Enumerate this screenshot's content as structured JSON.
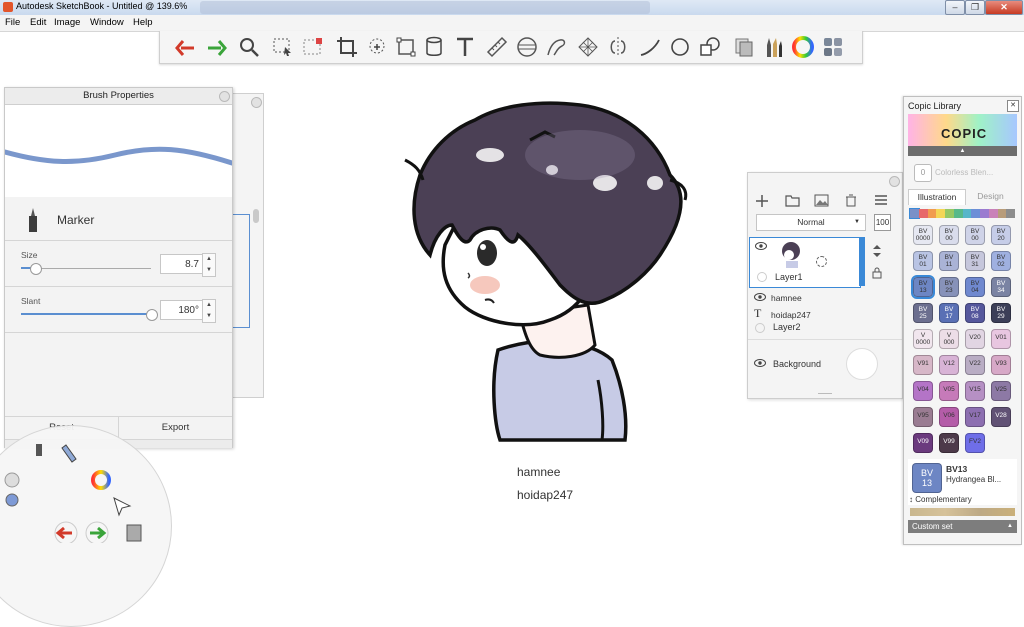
{
  "window": {
    "title": "Autodesk SketchBook - Untitled @ 139.6%",
    "controls": {
      "minimize": "‒",
      "maximize": "❐",
      "close": "✕"
    }
  },
  "menu": [
    "File",
    "Edit",
    "Image",
    "Window",
    "Help"
  ],
  "toolbar": {
    "tools": [
      "undo",
      "redo",
      "zoom",
      "select",
      "crop-select",
      "crop",
      "lasso-transform",
      "distort",
      "cylinder",
      "text",
      "ruler",
      "ellipse",
      "french-curve",
      "perspective-grid",
      "symmetry",
      "stroke-line",
      "circle",
      "shapes",
      "layer-copy",
      "brush-library",
      "color-wheel",
      "copic-library"
    ]
  },
  "brush_properties": {
    "title": "Brush Properties",
    "brush_name": "Marker",
    "size_label": "Size",
    "size_value": "8.7",
    "size_fraction": 0.11,
    "slant_label": "Slant",
    "slant_value": "180°",
    "slant_fraction": 1.0,
    "reset_label": "Reset",
    "export_label": "Export",
    "stroke_color": "#7a97cc"
  },
  "layers": {
    "blend_mode": "Normal",
    "opacity": "100",
    "items": [
      {
        "name": "Layer1",
        "type": "image",
        "selected": true
      },
      {
        "name": "hamnee",
        "type": "text"
      },
      {
        "name": "hoidap247",
        "type": "text"
      },
      {
        "name": "Layer2",
        "type": "group"
      },
      {
        "name": "Background",
        "type": "background"
      }
    ]
  },
  "copic": {
    "title": "Copic Library",
    "logo_text": "COPIC",
    "colorless_label": "Colorless Blen...",
    "colorless_code": "0",
    "tab_illustration": "Illustration",
    "tab_design": "Design",
    "swatches": [
      {
        "code": "BV\n0000",
        "color": "#e6e8f2"
      },
      {
        "code": "BV\n00",
        "color": "#d9dcec"
      },
      {
        "code": "BV\n00",
        "color": "#cfd3e8"
      },
      {
        "code": "BV\n20",
        "color": "#c6cde8"
      },
      {
        "code": "BV\n01",
        "color": "#b9c4e4"
      },
      {
        "code": "BV\n11",
        "color": "#aab3d6"
      },
      {
        "code": "BV\n31",
        "color": "#c6c7dc"
      },
      {
        "code": "BV\n02",
        "color": "#9fb0e0"
      },
      {
        "code": "BV\n13",
        "color": "#6d86c4"
      },
      {
        "code": "BV\n23",
        "color": "#8792b9"
      },
      {
        "code": "BV\n04",
        "color": "#6f88cf"
      },
      {
        "code": "BV\n34",
        "color": "#7a83a3"
      },
      {
        "code": "BV\n25",
        "color": "#6c6f8f"
      },
      {
        "code": "BV\n17",
        "color": "#5a70b5"
      },
      {
        "code": "BV\n08",
        "color": "#55579c"
      },
      {
        "code": "BV\n29",
        "color": "#3c3f58"
      },
      {
        "code": "V\n0000",
        "color": "#f1e6ee"
      },
      {
        "code": "V\n000",
        "color": "#ecdde7"
      },
      {
        "code": "V20",
        "color": "#e1d5e3"
      },
      {
        "code": "V01",
        "color": "#e8c6e0"
      },
      {
        "code": "V91",
        "color": "#d7b7c8"
      },
      {
        "code": "V12",
        "color": "#d8b3d6"
      },
      {
        "code": "V22",
        "color": "#b9adc4"
      },
      {
        "code": "V93",
        "color": "#d7a8c7"
      },
      {
        "code": "V04",
        "color": "#b474c7"
      },
      {
        "code": "V05",
        "color": "#c67ab9"
      },
      {
        "code": "V15",
        "color": "#b690c4"
      },
      {
        "code": "V25",
        "color": "#8d79a5"
      },
      {
        "code": "V95",
        "color": "#9a7c92"
      },
      {
        "code": "V06",
        "color": "#b45ca8"
      },
      {
        "code": "V17",
        "color": "#8d6fb1"
      },
      {
        "code": "V28",
        "color": "#615275"
      },
      {
        "code": "V09",
        "color": "#6b3a7e"
      },
      {
        "code": "V99",
        "color": "#4d3a4a"
      },
      {
        "code": "FV2",
        "color": "#6f6ee8"
      }
    ],
    "selected": {
      "code": "BV\n13",
      "name": "BV13",
      "full_name": "Hydrangea Bl...",
      "color": "#6d86c4"
    },
    "complementary_label": "Complementary",
    "custom_set_label": "Custom set"
  },
  "canvas": {
    "label1": "hamnee",
    "label2": "hoidap247",
    "hair_color": "#4b4055",
    "shirt_color": "#c7cbe6",
    "skin_color": "#ffffff",
    "cheek_color": "#f6c8bd"
  },
  "colors": {
    "accent": "#3a89d7",
    "panel": "#f4f4f4"
  }
}
